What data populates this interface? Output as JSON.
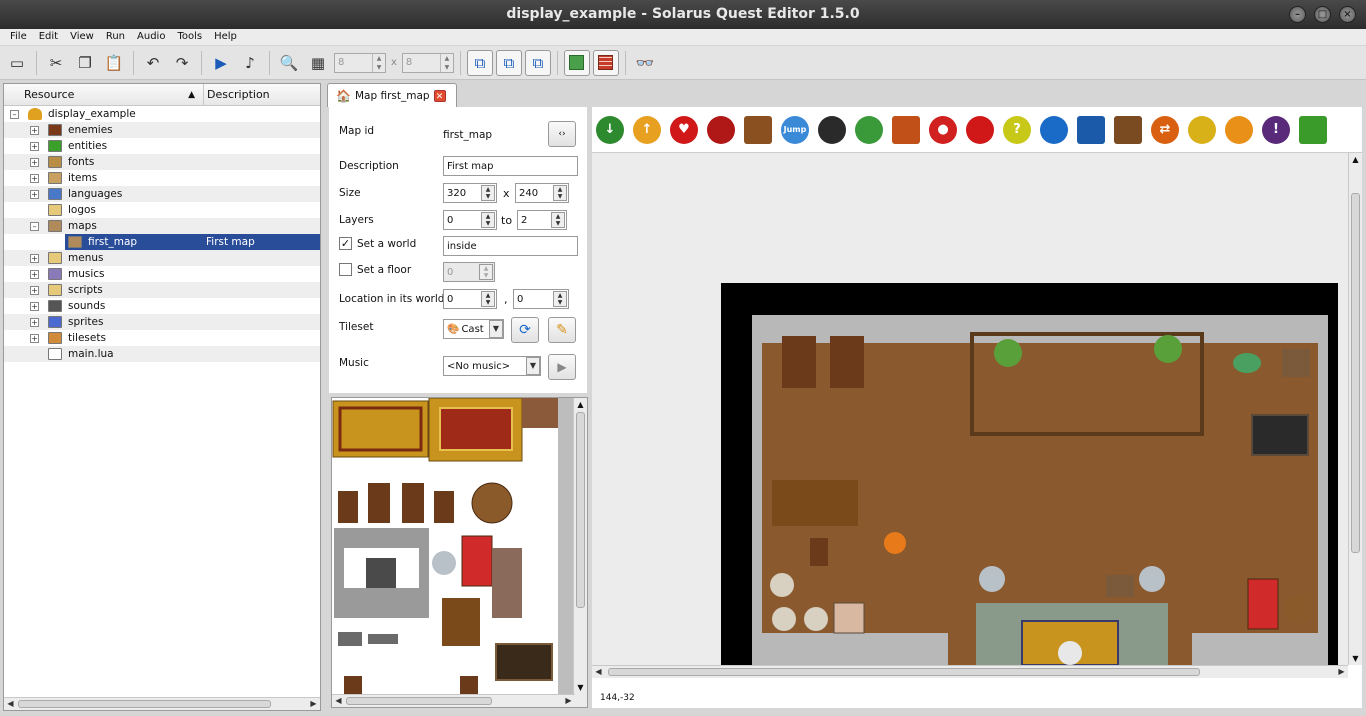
{
  "window": {
    "title": "display_example - Solarus Quest Editor 1.5.0"
  },
  "menu": {
    "items": [
      "File",
      "Edit",
      "View",
      "Run",
      "Audio",
      "Tools",
      "Help"
    ]
  },
  "toolbar": {
    "grid_width": "8",
    "grid_height": "8",
    "grid_sep": "x"
  },
  "tree": {
    "col_resource": "Resource",
    "col_description": "Description",
    "root": "display_example",
    "items": [
      {
        "label": "enemies",
        "icon": "enemy-icon",
        "color": "#7a3a1a",
        "expandable": true
      },
      {
        "label": "entities",
        "icon": "entity-icon",
        "color": "#3aa02a",
        "expandable": true
      },
      {
        "label": "fonts",
        "icon": "font-icon",
        "color": "#b88d45",
        "expandable": true
      },
      {
        "label": "items",
        "icon": "item-icon",
        "color": "#c8a060",
        "expandable": true
      },
      {
        "label": "languages",
        "icon": "language-icon",
        "color": "#4a78c8",
        "expandable": true
      },
      {
        "label": "logos",
        "icon": "folder-icon",
        "color": "#e7c97a",
        "expandable": false
      },
      {
        "label": "maps",
        "icon": "map-icon",
        "color": "#b08a5a",
        "expandable": true,
        "expanded": true
      },
      {
        "label": "first_map",
        "icon": "map-icon",
        "color": "#b08a5a",
        "child": true,
        "selected": true,
        "description": "First map"
      },
      {
        "label": "menus",
        "icon": "folder-icon",
        "color": "#e7c97a",
        "expandable": true
      },
      {
        "label": "musics",
        "icon": "music-icon",
        "color": "#8a7ab8",
        "expandable": true
      },
      {
        "label": "scripts",
        "icon": "script-icon",
        "color": "#e7c97a",
        "expandable": true
      },
      {
        "label": "sounds",
        "icon": "sound-icon",
        "color": "#555555",
        "expandable": true
      },
      {
        "label": "sprites",
        "icon": "sprite-icon",
        "color": "#4a6ad0",
        "expandable": true
      },
      {
        "label": "tilesets",
        "icon": "tileset-icon",
        "color": "#d08a3a",
        "expandable": true
      },
      {
        "label": "main.lua",
        "icon": "lua-file-icon",
        "color": "#ffffff",
        "expandable": false
      }
    ]
  },
  "tab": {
    "label": "Map first_map"
  },
  "props": {
    "map_id_label": "Map id",
    "map_id": "first_map",
    "description_label": "Description",
    "description": "First map",
    "size_label": "Size",
    "width": "320",
    "size_sep": "x",
    "height": "240",
    "layers_label": "Layers",
    "layer_min": "0",
    "layers_sep": "to",
    "layer_max": "2",
    "world_label": "Set a world",
    "world": "inside",
    "floor_label": "Set a floor",
    "floor": "0",
    "location_label": "Location in its world",
    "loc_x": "0",
    "loc_sep": ",",
    "loc_y": "0",
    "tileset_label": "Tileset",
    "tileset": "Cast",
    "music_label": "Music",
    "music": "<No music>"
  },
  "palette": [
    {
      "name": "destination-icon",
      "color": "#2e8a2e",
      "glyph": "↓"
    },
    {
      "name": "teletransporter-icon",
      "color": "#e8a020",
      "glyph": "↑"
    },
    {
      "name": "pickable-heart-icon",
      "color": "#d01818",
      "glyph": "♥"
    },
    {
      "name": "destructible-pot-icon",
      "color": "#b01818",
      "glyph": ""
    },
    {
      "name": "chest-icon",
      "color": "#8a5020",
      "glyph": ""
    },
    {
      "name": "jumper-icon",
      "color": "#3a8ad8",
      "glyph": "Jump"
    },
    {
      "name": "enemy-icon",
      "color": "#2a2a2a",
      "glyph": ""
    },
    {
      "name": "npc-icon",
      "color": "#3a9a3a",
      "glyph": ""
    },
    {
      "name": "block-icon",
      "color": "#c05018",
      "glyph": ""
    },
    {
      "name": "switch-icon",
      "color": "#d02020",
      "glyph": "●"
    },
    {
      "name": "wall-icon",
      "color": "#d01818",
      "glyph": ""
    },
    {
      "name": "sensor-icon",
      "color": "#c8c818",
      "glyph": "?"
    },
    {
      "name": "crystal-icon",
      "color": "#1a6ac8",
      "glyph": ""
    },
    {
      "name": "crystal-block-icon",
      "color": "#1a5aa8",
      "glyph": ""
    },
    {
      "name": "shop-treasure-icon",
      "color": "#7a4a20",
      "glyph": ""
    },
    {
      "name": "conveyor-belt-icon",
      "color": "#d86010",
      "glyph": "⇄"
    },
    {
      "name": "door-icon",
      "color": "#d8b018",
      "glyph": ""
    },
    {
      "name": "stairs-icon",
      "color": "#e89018",
      "glyph": ""
    },
    {
      "name": "separator-icon",
      "color": "#5a2a7a",
      "glyph": "!"
    },
    {
      "name": "custom-entity-icon",
      "color": "#3a9a2a",
      "glyph": ""
    }
  ],
  "status": {
    "coords": "144,-32"
  }
}
